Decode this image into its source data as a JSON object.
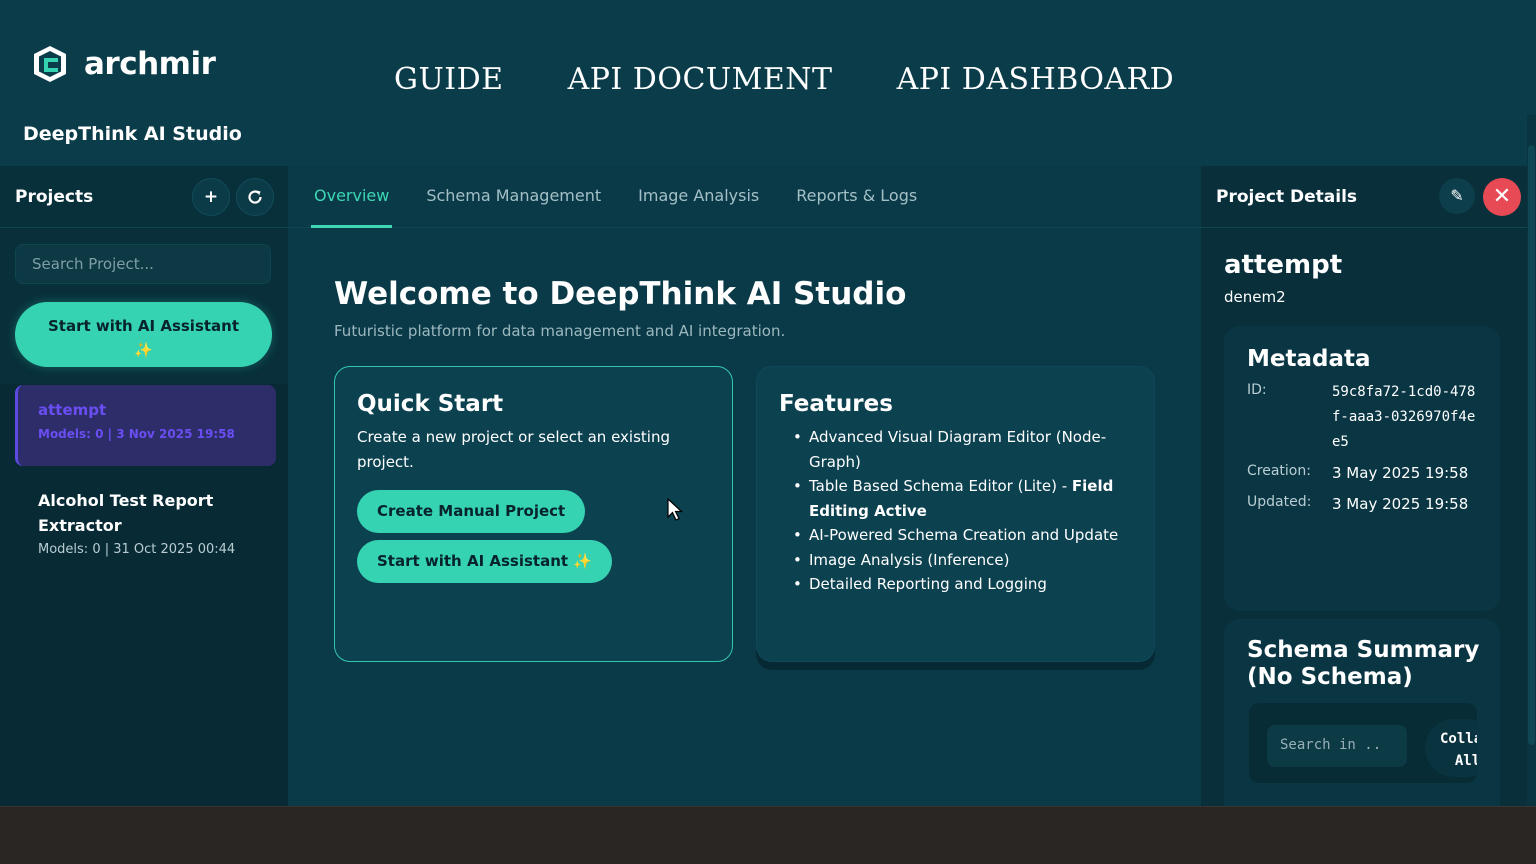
{
  "brand": {
    "name": "archmir",
    "studio": "DeepThink AI Studio"
  },
  "topnav": [
    "GUIDE",
    "API DOCUMENT",
    "API DASHBOARD"
  ],
  "sidebar": {
    "title": "Projects",
    "add_icon": "plus-icon",
    "refresh_icon": "refresh-icon",
    "search_placeholder": "Search Project...",
    "ai_button": "Start with AI Assistant",
    "projects": [
      {
        "name": "attempt",
        "meta": "Models: 0 | 3 Nov 2025 19:58",
        "active": true
      },
      {
        "name": "Alcohol Test Report Extractor",
        "meta": "Models: 0 | 31 Oct 2025 00:44",
        "active": false
      }
    ]
  },
  "main": {
    "tabs": [
      "Overview",
      "Schema Management",
      "Image Analysis",
      "Reports & Logs"
    ],
    "active_tab": "Overview",
    "welcome": "Welcome to DeepThink AI Studio",
    "subtitle": "Futuristic platform for data management and AI integration.",
    "quick_start": {
      "title": "Quick Start",
      "text": "Create a new project or select an existing project.",
      "manual_button": "Create Manual Project",
      "ai_button": "Start with AI Assistant"
    },
    "features": {
      "title": "Features",
      "items": [
        "Advanced Visual Diagram Editor (Node-Graph)",
        "Table Based Schema Editor (Lite) -",
        "AI-Powered Schema Creation and Update",
        "Image Analysis (Inference)",
        "Detailed Reporting and Logging"
      ],
      "item2_bold": "Field Editing Active"
    }
  },
  "details": {
    "title": "Project Details",
    "project_name": "attempt",
    "project_sub": "denem2",
    "metadata": {
      "title": "Metadata",
      "id_label": "ID:",
      "id_value": "59c8fa72-1cd0-478f-aaa3-0326970f4ee5",
      "creation_label": "Creation:",
      "creation_value": "3 May 2025 19:58",
      "updated_label": "Updated:",
      "updated_value": "3 May 2025 19:58"
    },
    "schema": {
      "title": "Schema Summary (No Schema)",
      "search_placeholder": "Search in ..",
      "collapse_label": "Collapse All"
    }
  },
  "colors": {
    "accent": "#35d3b2",
    "active_project": "#6a4ef2",
    "close": "#e84a55",
    "bg": "#0a3a48"
  }
}
